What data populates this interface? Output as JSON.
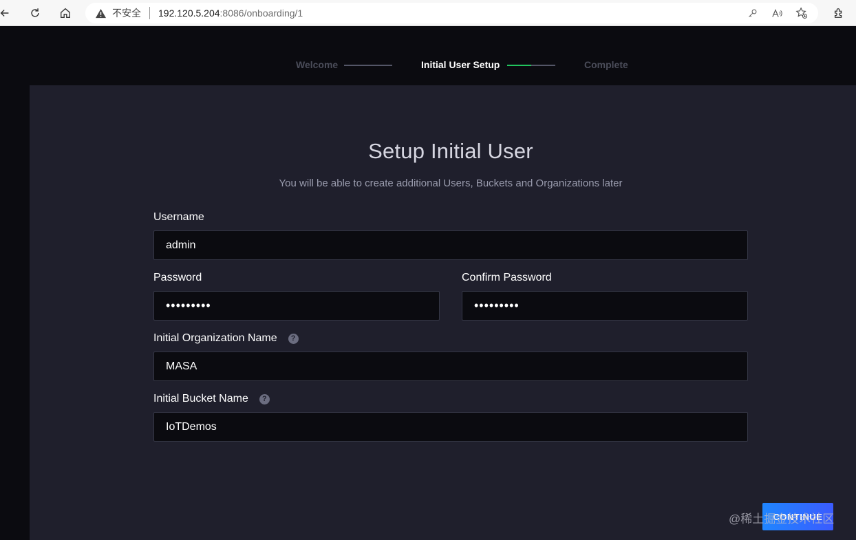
{
  "browser": {
    "security_label": "不安全",
    "url_host": "192.120.5.204",
    "url_path": ":8086/onboarding/1"
  },
  "stepper": {
    "steps": [
      {
        "label": "Welcome",
        "state": "done"
      },
      {
        "label": "Initial User Setup",
        "state": "active"
      },
      {
        "label": "Complete",
        "state": "pending"
      }
    ],
    "active_progress": 0.5,
    "accent": "#22c55e"
  },
  "form": {
    "title": "Setup Initial User",
    "subtitle": "You will be able to create additional Users, Buckets and Organizations later",
    "username_label": "Username",
    "username_value": "admin",
    "password_label": "Password",
    "password_value": "•••••••••",
    "confirm_label": "Confirm Password",
    "confirm_value": "•••••••••",
    "org_label": "Initial Organization Name",
    "org_value": "MASA",
    "bucket_label": "Initial Bucket Name",
    "bucket_value": "IoTDemos",
    "help_glyph": "?"
  },
  "actions": {
    "continue_label": "CONTINUE",
    "continue_color": "#1f86ff"
  },
  "watermark": "@稀土掘金技术社区"
}
